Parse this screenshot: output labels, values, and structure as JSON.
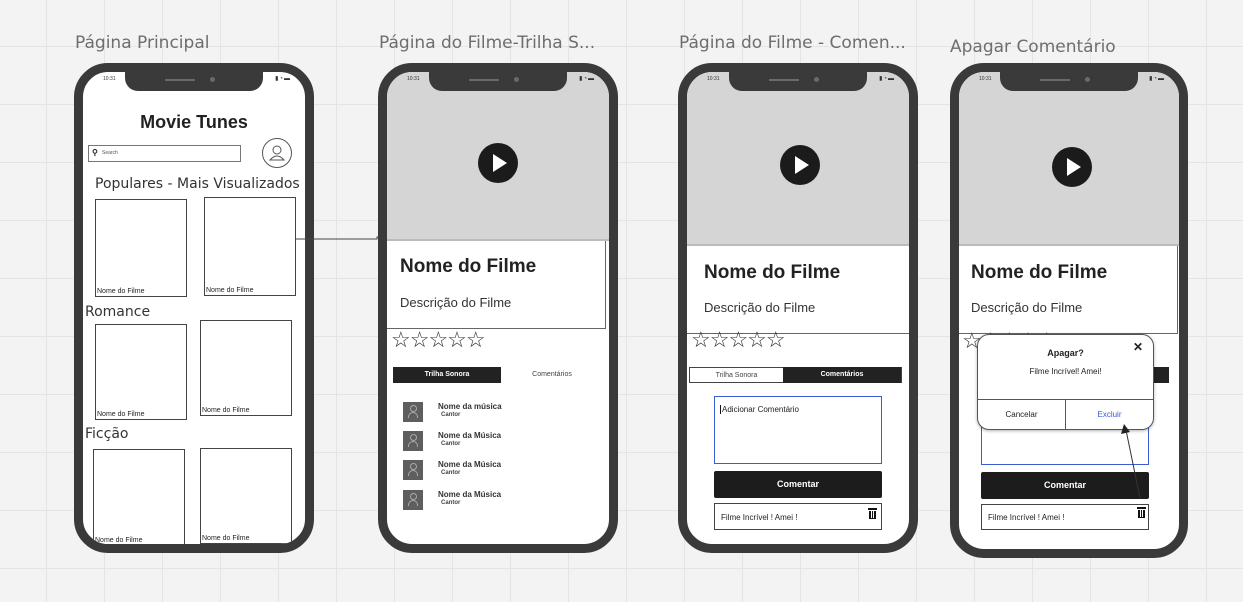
{
  "screens": {
    "home": {
      "caption": "Página Principal",
      "time": "10:31",
      "app_title": "Movie Tunes",
      "search_placeholder": "Search",
      "section_popular": "Populares - Mais Visualizados",
      "section_romance": "Romance",
      "section_fiction": "Ficção",
      "movie_label": "Nome do Filme"
    },
    "soundtrack": {
      "caption": "Página do Filme-Trilha S...",
      "time": "10:31",
      "movie_title": "Nome do Filme",
      "movie_description": "Descrição do Filme",
      "stars": "☆☆☆☆☆",
      "tabs": [
        "Trilha Sonora",
        "Comentários"
      ],
      "songs": [
        {
          "name": "Nome da música",
          "artist": "Cantor"
        },
        {
          "name": "Nome da Música",
          "artist": "Cantor"
        },
        {
          "name": "Nome da Música",
          "artist": "Cantor"
        },
        {
          "name": "Nome da Música",
          "artist": "Cantor"
        }
      ]
    },
    "comments": {
      "caption": "Página do Filme - Comen...",
      "time": "10:31",
      "movie_title": "Nome do Filme",
      "movie_description": "Descrição do Filme",
      "stars": "☆☆☆☆☆",
      "tabs": [
        "Trilha Sonora",
        "Comentários"
      ],
      "comment_input": "Adicionar Comentário",
      "submit_label": "Comentar",
      "existing_comment": "Filme Incrível ! Amei !"
    },
    "delete": {
      "caption": "Apagar Comentário",
      "time": "10:31",
      "movie_title": "Nome do Filme",
      "movie_description": "Descrição do Filme",
      "stars": "☆☆☆☆☆",
      "submit_label": "Comentar",
      "existing_comment": "Filme Incrível ! Amei !",
      "dialog": {
        "title": "Apagar?",
        "message": "Filme Incrível! Amei!",
        "close": "✕",
        "cancel": "Cancelar",
        "confirm": "Excluir"
      }
    }
  },
  "status_icons": "▮◔▬",
  "colors": {
    "frame": "#3a3a3a",
    "video": "#d5d5d5",
    "link": "#3c5bd6",
    "tab_active": "#222222"
  }
}
